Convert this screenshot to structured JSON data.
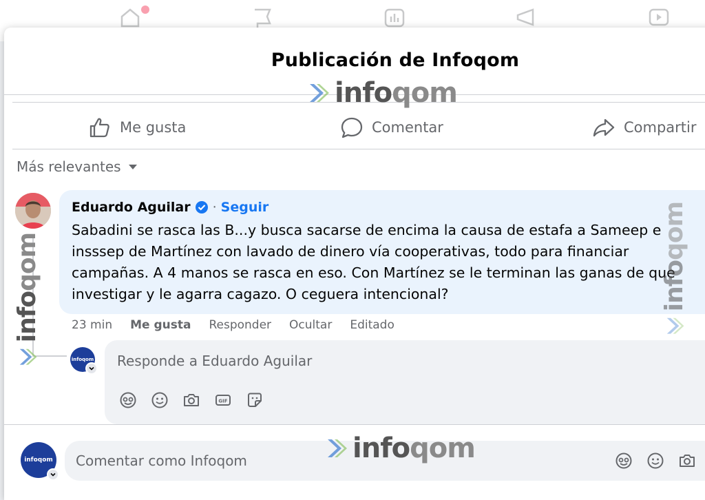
{
  "modal": {
    "title": "Publicación de Infoqom"
  },
  "actions": {
    "like": "Me gusta",
    "comment": "Comentar",
    "share": "Compartir"
  },
  "sort": {
    "label": "Más relevantes"
  },
  "comment": {
    "author": "Eduardo Aguilar",
    "follow_separator": "·",
    "follow_label": "Seguir",
    "lines": [
      "Sabadini se rasca las B...y busca sacarse de encima la causa de estafa a Sameep e",
      "insssep de Martínez con lavado de dinero vía cooperativas, todo para financiar",
      "campañas. A 4 manos se rasca en eso. Con Martínez se le terminan las ganas de que",
      "investigar y le agarra cagazo. O ceguera intencional?"
    ],
    "time": "23 min",
    "like": "Me gusta",
    "reply": "Responder",
    "hide": "Ocultar",
    "edited": "Editado"
  },
  "reply": {
    "placeholder": "Responde a Eduardo Aguilar",
    "tools": [
      "avatar-sticker-icon",
      "emoji-icon",
      "camera-icon",
      "gif-icon",
      "sticker-icon"
    ]
  },
  "composer": {
    "placeholder": "Comentar como Infoqom",
    "tools": [
      "avatar-sticker-icon",
      "emoji-icon",
      "camera-icon"
    ]
  },
  "page_avatar_label": "infoqom",
  "watermark": {
    "prefix": "info",
    "suffix": "qom"
  },
  "colors": {
    "accent": "#1877f2",
    "bubble": "#eaf3fd",
    "secondary_text": "#65676b",
    "page_avatar": "#1d3e9a"
  }
}
